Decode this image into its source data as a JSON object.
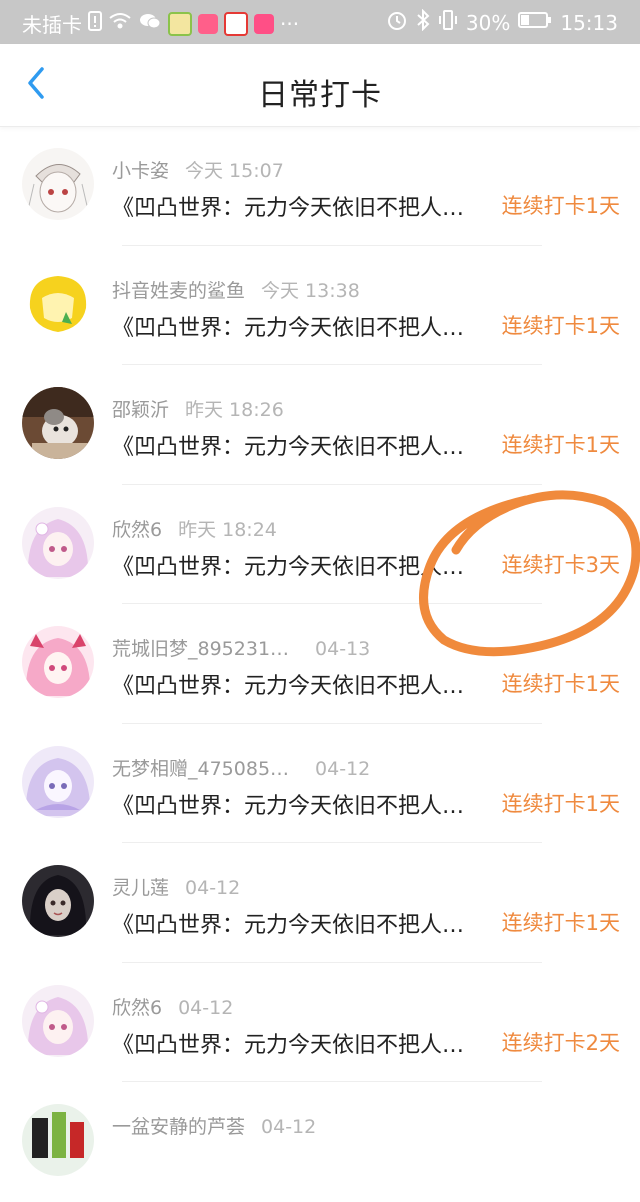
{
  "status_bar": {
    "carrier": "未插卡",
    "battery": "30%",
    "time": "15:13"
  },
  "header": {
    "title": "日常打卡",
    "back_icon": "chevron-left-icon"
  },
  "colors": {
    "accent": "#ef8a3f",
    "back_icon": "#2f9bf0",
    "annotation": "#f08a3c"
  },
  "checkins": [
    {
      "name": "小卡姿",
      "time": "今天 15:07",
      "content": "《凹凸世界：元力今天依旧不把人…",
      "streak": "连续打卡1天"
    },
    {
      "name": "抖音姓麦的鲨鱼",
      "time": "今天 13:38",
      "content": "《凹凸世界：元力今天依旧不把人…",
      "streak": "连续打卡1天"
    },
    {
      "name": "邵颖沂",
      "time": "昨天 18:26",
      "content": "《凹凸世界：元力今天依旧不把人…",
      "streak": "连续打卡1天"
    },
    {
      "name": "欣然6",
      "time": "昨天 18:24",
      "content": "《凹凸世界：元力今天依旧不把人…",
      "streak": "连续打卡3天"
    },
    {
      "name": "荒城旧梦_895231…",
      "time": "04-13",
      "content": "《凹凸世界：元力今天依旧不把人…",
      "streak": "连续打卡1天"
    },
    {
      "name": "无梦相赠_475085…",
      "time": "04-12",
      "content": "《凹凸世界：元力今天依旧不把人…",
      "streak": "连续打卡1天"
    },
    {
      "name": "灵儿莲",
      "time": "04-12",
      "content": "《凹凸世界：元力今天依旧不把人…",
      "streak": "连续打卡1天"
    },
    {
      "name": "欣然6",
      "time": "04-12",
      "content": "《凹凸世界：元力今天依旧不把人…",
      "streak": "连续打卡2天"
    },
    {
      "name": "一盆安静的芦荟",
      "time": "04-12",
      "content": "",
      "streak": ""
    }
  ]
}
